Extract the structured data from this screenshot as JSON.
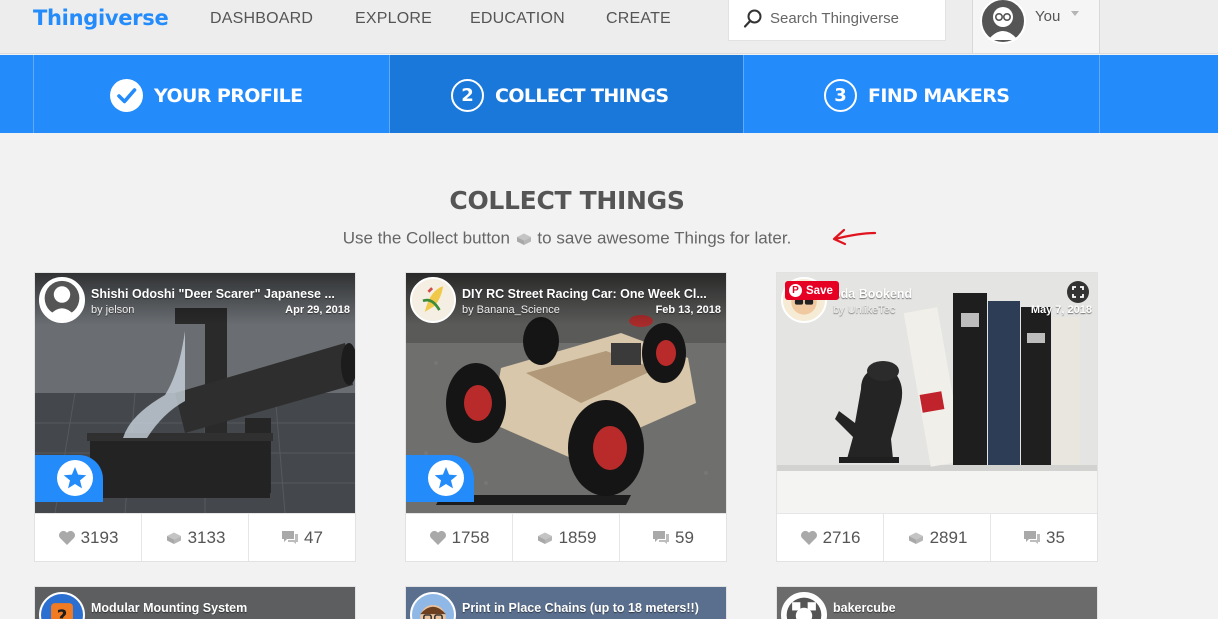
{
  "nav": {
    "logo": "Thingiverse",
    "links": [
      "DASHBOARD",
      "EXPLORE",
      "EDUCATION",
      "CREATE"
    ],
    "search_placeholder": "Search Thingiverse",
    "user_label": "You"
  },
  "steps": [
    {
      "label": "YOUR PROFILE",
      "marker": "check-icon",
      "state": "done"
    },
    {
      "number": "2",
      "label": "COLLECT THINGS",
      "state": "active"
    },
    {
      "number": "3",
      "label": "FIND MAKERS",
      "state": "todo"
    }
  ],
  "heading": "COLLECT THINGS",
  "subheading": {
    "before": "Use the Collect button",
    "icon": "collect-icon",
    "after": "to save awesome Things for later."
  },
  "cards": [
    {
      "title": "Shishi Odoshi \"Deer Scarer\" Japanese ...",
      "author": "by jelson",
      "date": "Apr 29, 2018",
      "likes": "3193",
      "collects": "3133",
      "comments": "47",
      "featured": true
    },
    {
      "title": "DIY RC Street Racing Car: One Week Cl...",
      "author": "by Banana_Science",
      "date": "Feb 13, 2018",
      "likes": "1758",
      "collects": "1859",
      "comments": "59",
      "featured": true
    },
    {
      "title": "oda Bookend",
      "author": "by UnlikeTec",
      "date": "May 7, 2018",
      "likes": "2716",
      "collects": "2891",
      "comments": "35",
      "featured": false,
      "save_label": "Save"
    }
  ],
  "cards_row2": [
    {
      "title": "Modular Mounting System"
    },
    {
      "title": "Print in Place Chains (up to 18 meters!!)"
    },
    {
      "title": "bakercube"
    }
  ],
  "colors": {
    "brand": "#248bfb",
    "active_step": "#1a78da",
    "pinterest": "#e60023",
    "annotation": "#e0141e"
  }
}
